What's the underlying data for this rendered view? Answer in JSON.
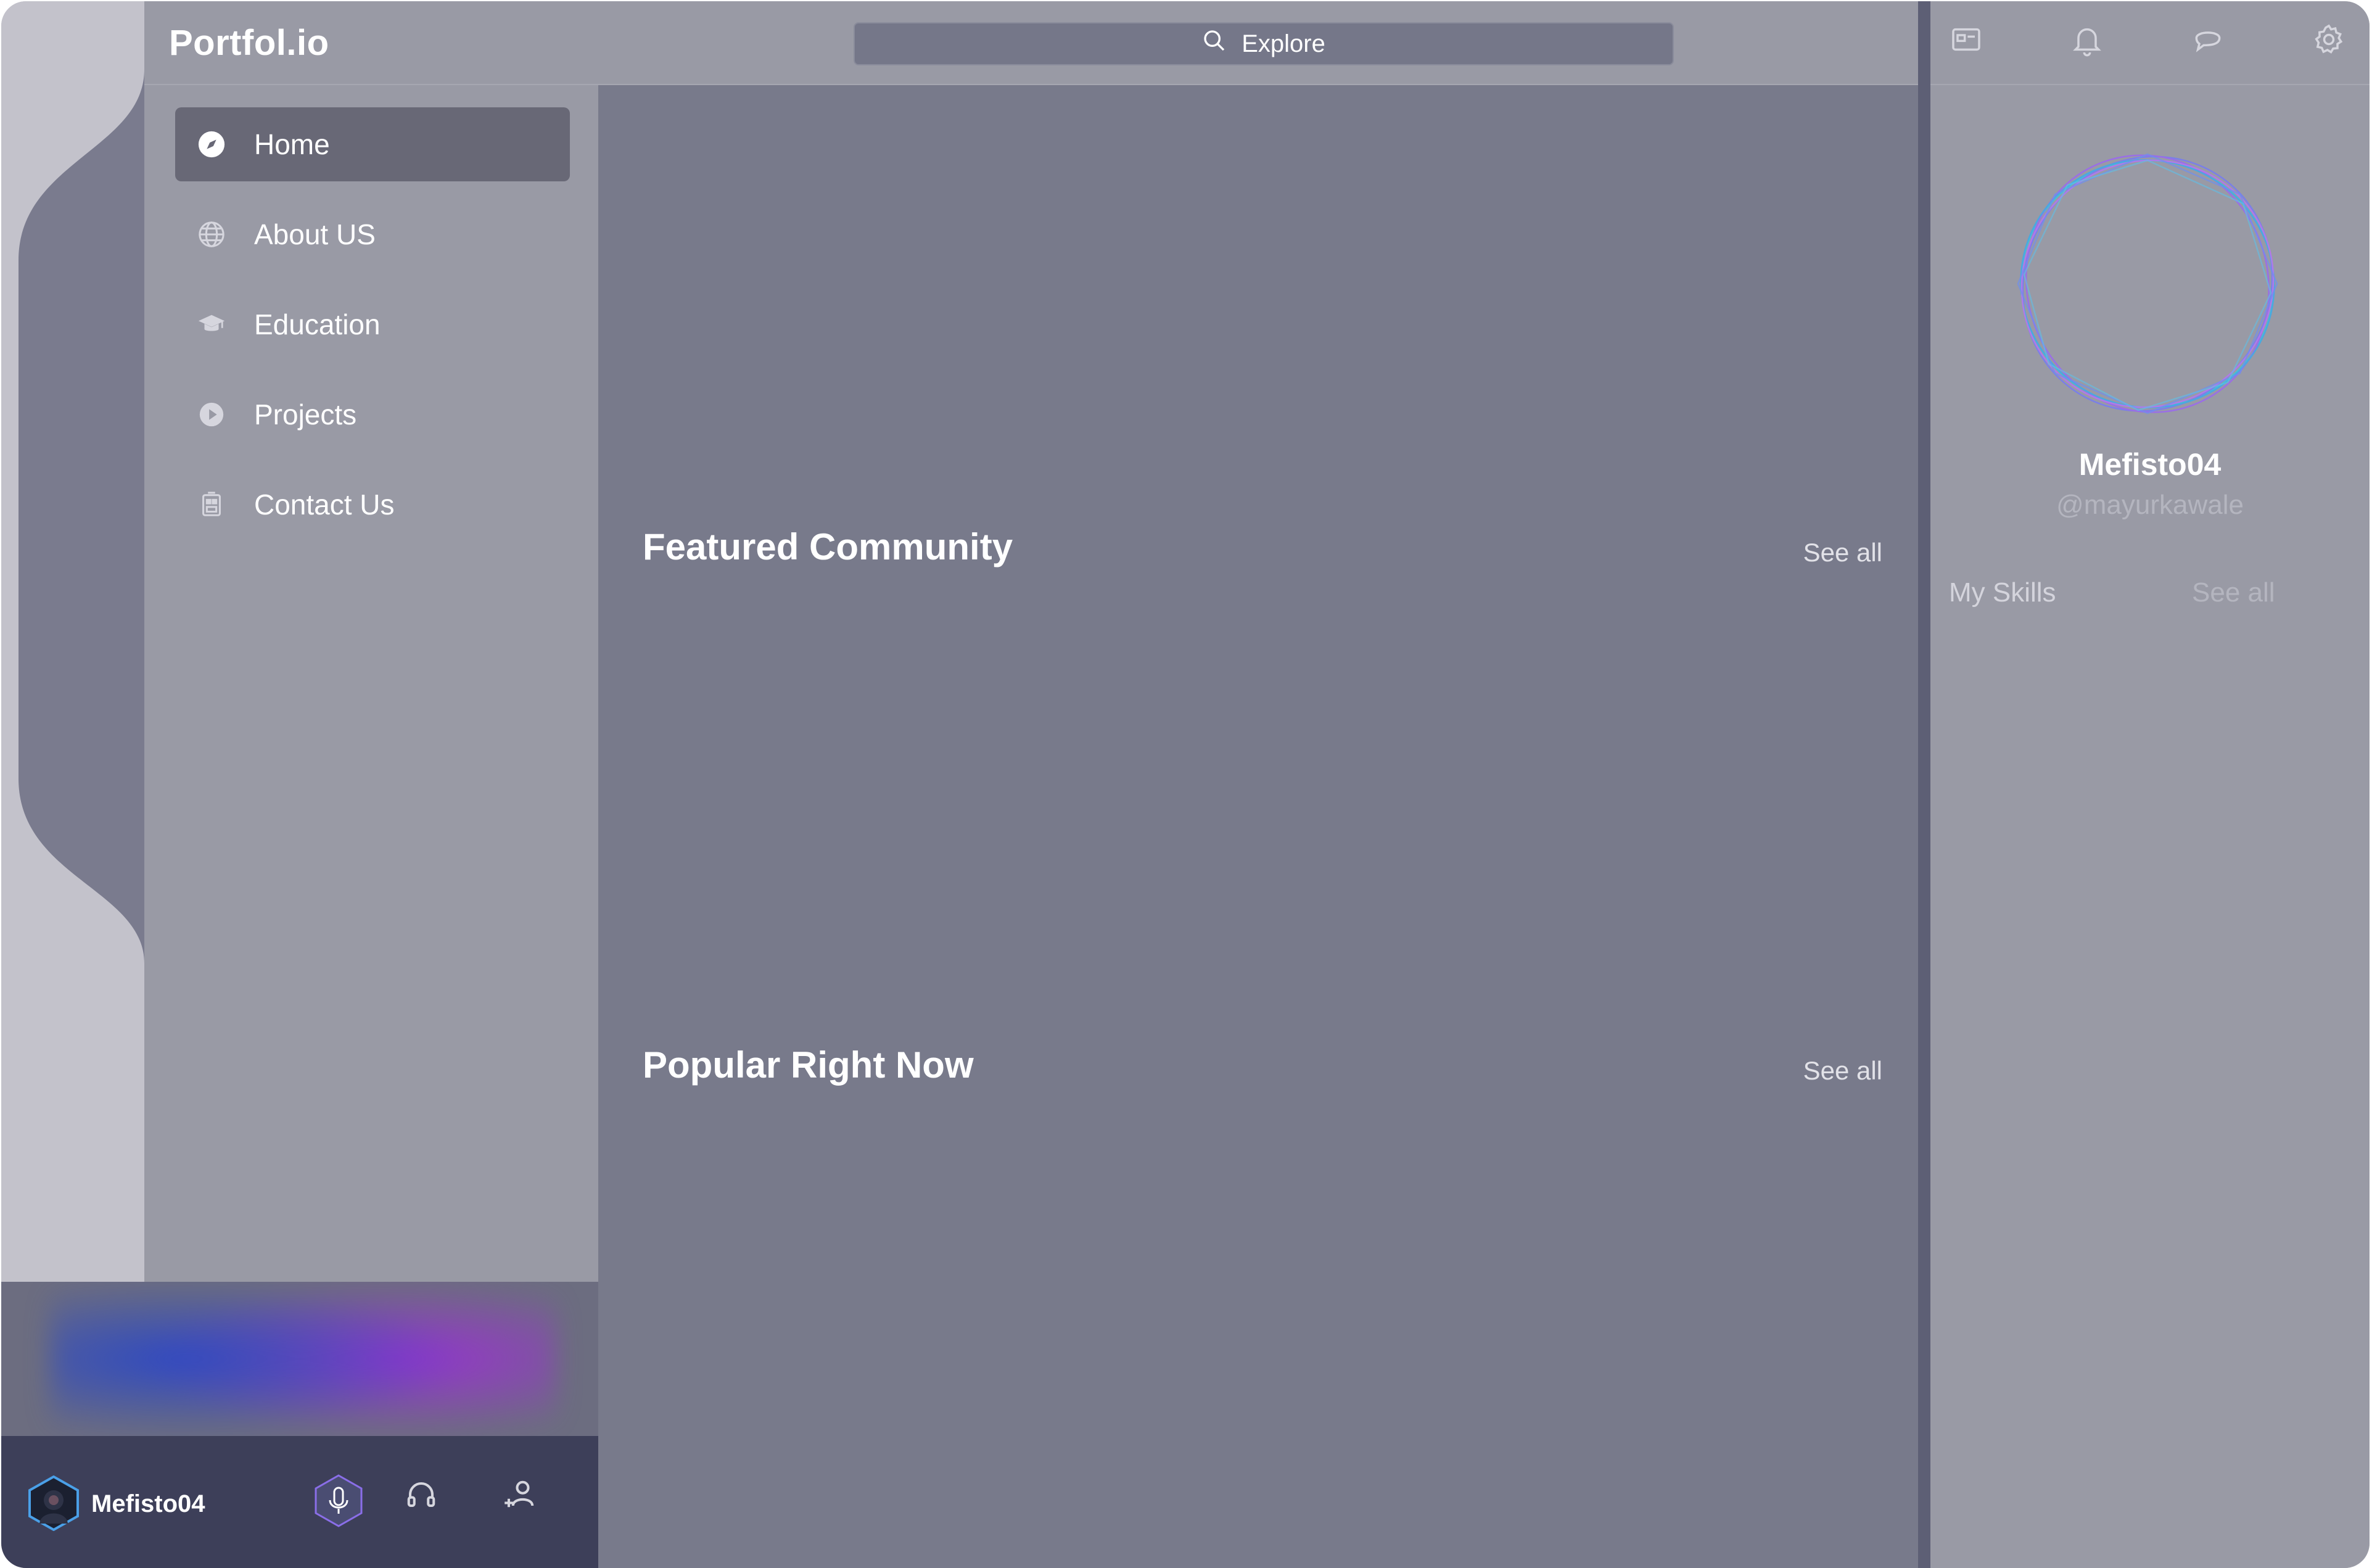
{
  "app": {
    "logo": "Portfol.io"
  },
  "search": {
    "label": "Explore",
    "icon": "search-icon"
  },
  "sidebar": {
    "items": [
      {
        "label": "Home",
        "icon": "compass-icon",
        "active": true
      },
      {
        "label": "About US",
        "icon": "globe-icon"
      },
      {
        "label": "Education",
        "icon": "graduation-cap-icon"
      },
      {
        "label": "Projects",
        "icon": "play-circle-icon"
      },
      {
        "label": "Contact Us",
        "icon": "contact-icon"
      }
    ]
  },
  "main": {
    "sections": [
      {
        "title": "Featured Community",
        "see_all": "See all"
      },
      {
        "title": "Popular Right Now",
        "see_all": "See all"
      }
    ]
  },
  "player": {
    "username": "Mefisto04",
    "icons": [
      "microphone-icon",
      "headphones-icon",
      "add-user-icon"
    ]
  },
  "topbar_right": {
    "icons": [
      "id-card-icon",
      "bell-icon",
      "chat-icon",
      "gear-icon"
    ]
  },
  "profile": {
    "name": "Mefisto04",
    "handle": "@mayurkawale",
    "skills_label": "My Skills",
    "skills_see_all": "See all"
  },
  "colors": {
    "sidebar": "#999aa5",
    "main": "#787a8b",
    "active_item": "#686876",
    "userbar": "#3d3f59",
    "wave_cyan": "#27c8ef",
    "wave_magenta": "#d23ee0"
  }
}
